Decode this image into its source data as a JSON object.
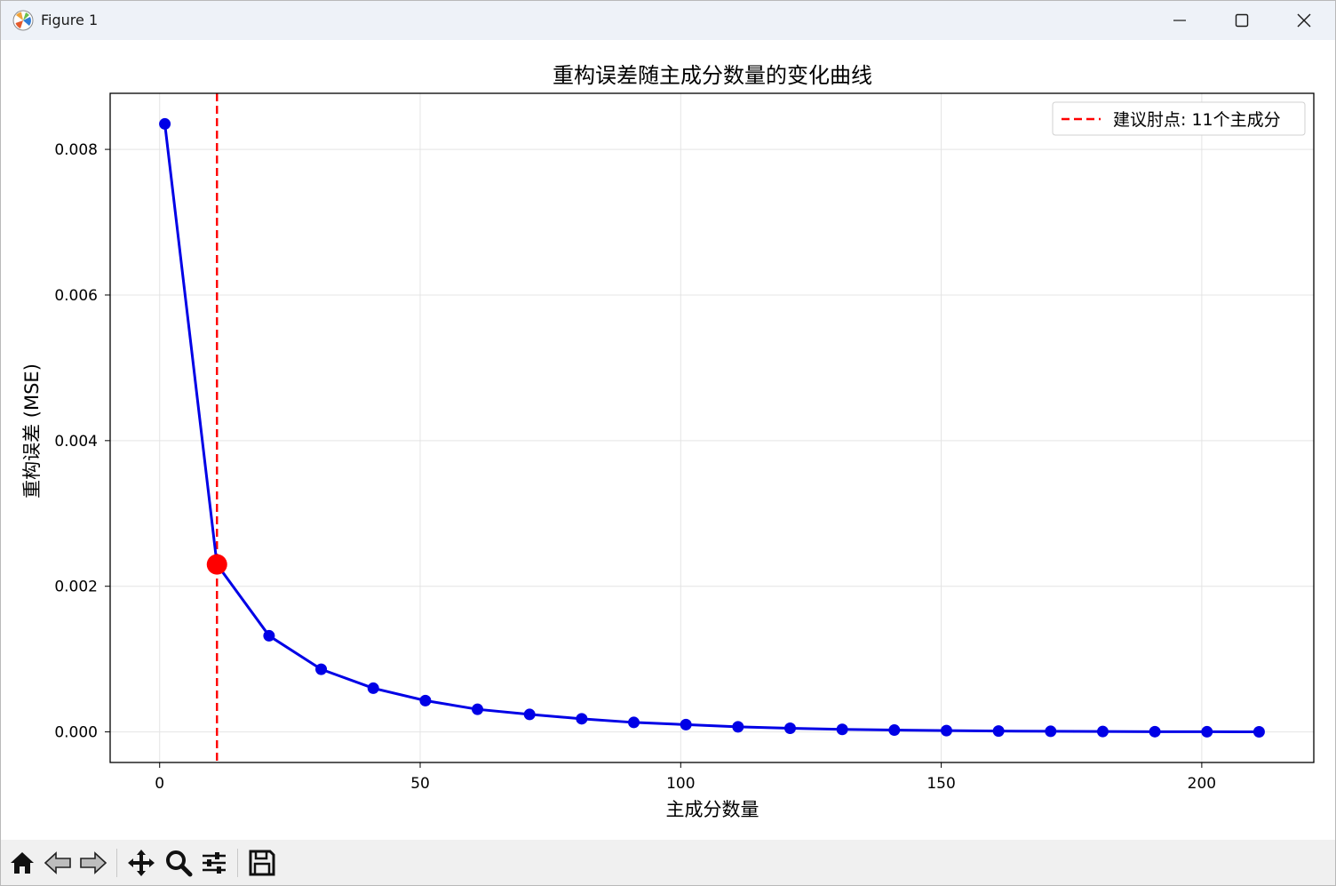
{
  "window": {
    "title": "Figure 1"
  },
  "toolbar": {
    "buttons": [
      "home-icon",
      "back-icon",
      "forward-icon",
      "pan-icon",
      "zoom-icon",
      "configure-icon",
      "save-icon"
    ]
  },
  "colors": {
    "series": "#0000e6",
    "highlight": "#ff0000",
    "grid": "#e4e4e4",
    "toolbar_bg": "#f0f0f0",
    "titlebar_bg": "#eef2f8"
  },
  "chart_data": {
    "type": "line",
    "title": "重构误差随主成分数量的变化曲线",
    "xlabel": "主成分数量",
    "ylabel": "重构误差 (MSE)",
    "xlim": [
      -9.5,
      221.5
    ],
    "ylim": [
      -0.00042,
      0.00877
    ],
    "xticks": [
      0,
      50,
      100,
      150,
      200
    ],
    "yticks": [
      0.0,
      0.002,
      0.004,
      0.006,
      0.008
    ],
    "ytick_labels": [
      "0.000",
      "0.002",
      "0.004",
      "0.006",
      "0.008"
    ],
    "grid": true,
    "legend_location": "upper right",
    "series": [
      {
        "x": [
          1,
          11,
          21,
          31,
          41,
          51,
          61,
          71,
          81,
          91,
          101,
          111,
          121,
          131,
          141,
          151,
          161,
          171,
          181,
          191,
          201,
          211
        ],
        "y": [
          0.00835,
          0.0023,
          0.00132,
          0.00086,
          0.0006,
          0.00043,
          0.00031,
          0.00024,
          0.00018,
          0.00013,
          0.0001,
          7e-05,
          5e-05,
          3.5e-05,
          2.5e-05,
          1.8e-05,
          1.2e-05,
          8e-06,
          5e-06,
          3e-06,
          2e-06,
          1e-06
        ]
      }
    ],
    "marker_point": {
      "x": 11,
      "y": 0.0023
    },
    "vline": {
      "x": 11,
      "label": "建议肘点: 11个主成分"
    }
  }
}
